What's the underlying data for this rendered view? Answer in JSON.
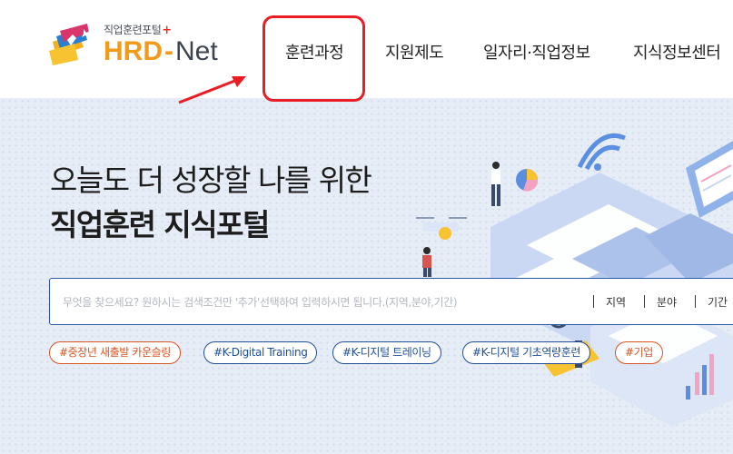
{
  "logo": {
    "subtitle": "직업훈련포털",
    "plus": "+",
    "hrd": "HRD",
    "dash": "-",
    "net": "Net"
  },
  "nav": {
    "items": [
      {
        "label": "훈련과정"
      },
      {
        "label": "지원제도"
      },
      {
        "label": "일자리·직업정보"
      },
      {
        "label": "지식정보센터"
      }
    ]
  },
  "hero": {
    "headline_line1": "오늘도 더 성장할 나를 위한",
    "headline_line2": "직업훈련 지식포털"
  },
  "search": {
    "placeholder": "무엇을 찾으세요? 원하시는 검색조건만 '추가'선택하여 입력하시면 됩니다.(지역,분야,기간)",
    "value": "",
    "filters": [
      {
        "label": "지역"
      },
      {
        "label": "분야"
      },
      {
        "label": "기간"
      }
    ]
  },
  "hashtags": [
    {
      "label": "#중장년 새출발 카운슬링",
      "color": "orange"
    },
    {
      "label": "#K-Digital Training",
      "color": "blue"
    },
    {
      "label": "#K-디지털 트레이닝",
      "color": "blue"
    },
    {
      "label": "#K-디지털 기초역량훈련",
      "color": "blue"
    },
    {
      "label": "#기업",
      "color": "orange"
    }
  ],
  "colors": {
    "brand_orange": "#f29a1a",
    "brand_blue": "#2c58a8",
    "highlight_red": "#ec1c24",
    "hero_background": "#e7edf7"
  },
  "icons": [
    "hrd-net-logo-icon",
    "red-arrow-icon",
    "hero-illustration"
  ]
}
